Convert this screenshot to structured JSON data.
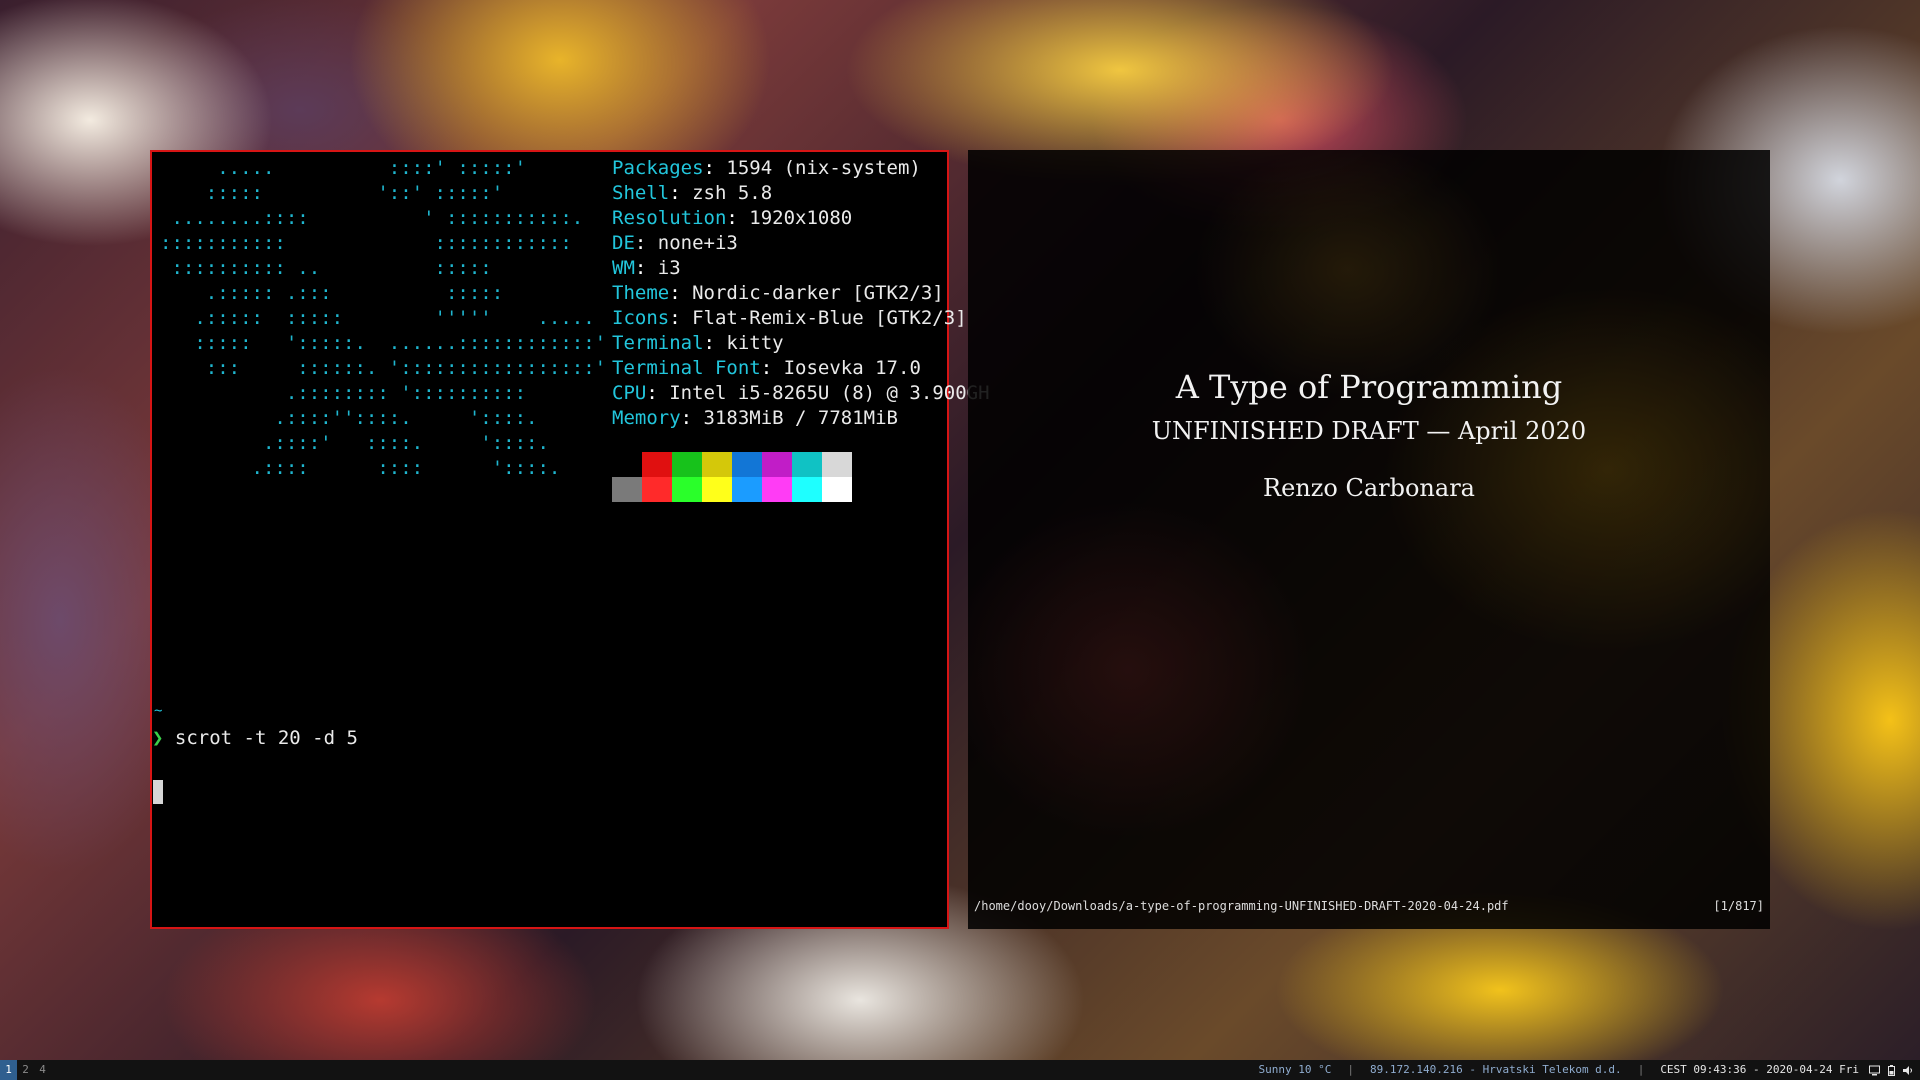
{
  "terminal": {
    "ascii_art": "     .....          ::::' :::::'\n    :::::          '::' :::::'\n ........::::          ' :::::::::::.\n:::::::::::             ::::::::::::\n :::::::::: ..          :::::\n    .::::: .:::          :::::\n   .:::::  :::::        '''''    .....\n   :::::   ':::::.  ......::::::::::::'\n    :::     ::::::. ':::::::::::::::::'\n           .:::::::: '::::::::::\n          .::::''::::.     '::::.\n         .::::'   ::::.     '::::.\n        .::::      ::::      '::::.",
    "info": [
      {
        "key": "Packages",
        "value": "1594 (nix-system)"
      },
      {
        "key": "Shell",
        "value": "zsh 5.8"
      },
      {
        "key": "Resolution",
        "value": "1920x1080"
      },
      {
        "key": "DE",
        "value": "none+i3"
      },
      {
        "key": "WM",
        "value": "i3"
      },
      {
        "key": "Theme",
        "value": "Nordic-darker [GTK2/3]"
      },
      {
        "key": "Icons",
        "value": "Flat-Remix-Blue [GTK2/3]"
      },
      {
        "key": "Terminal",
        "value": "kitty"
      },
      {
        "key": "Terminal Font",
        "value": "Iosevka 17.0"
      },
      {
        "key": "CPU",
        "value": "Intel i5-8265U (8) @ 3.900GH"
      },
      {
        "key": "Memory",
        "value": "3183MiB / 7781MiB"
      }
    ],
    "palette_dark": [
      "#000000",
      "#e01010",
      "#17c21b",
      "#d4c80a",
      "#1276d6",
      "#c11dc7",
      "#10c2c4",
      "#d8d8d8"
    ],
    "palette_bright": [
      "#7a7a7a",
      "#ff2a2a",
      "#2aff2a",
      "#ffff1a",
      "#1b9cff",
      "#ff3cf5",
      "#1effff",
      "#ffffff"
    ],
    "prompt_dir": "~",
    "prompt_symbol": "❯",
    "command": "scrot -t 20 -d 5"
  },
  "viewer": {
    "title": "A Type of Programming",
    "subtitle": "UNFINISHED DRAFT — April 2020",
    "author": "Renzo Carbonara",
    "file_path": "/home/dooy/Downloads/a-type-of-programming-UNFINISHED-DRAFT-2020-04-24.pdf",
    "page_indicator": "[1/817]"
  },
  "bar": {
    "workspaces": [
      "1",
      "2",
      "4"
    ],
    "active_workspace": "1",
    "weather": "Sunny 10 °C",
    "ip": "89.172.140.216 - Hrvatski Telekom d.d.",
    "datetime": "CEST 09:43:36 - 2020-04-24 Fri",
    "tray_icons": [
      "monitor-icon",
      "battery-icon",
      "volume-icon"
    ]
  }
}
